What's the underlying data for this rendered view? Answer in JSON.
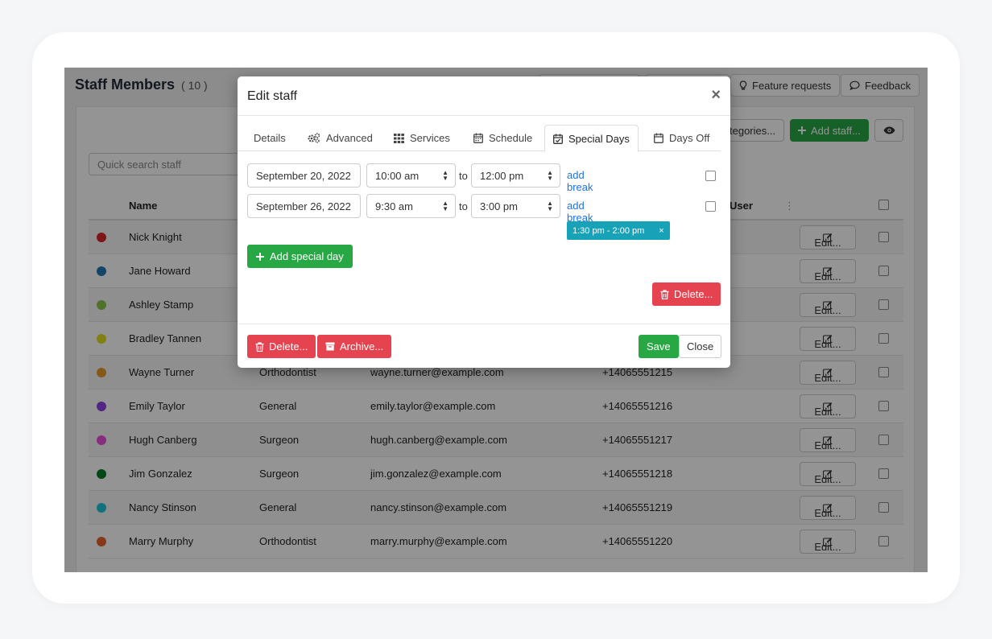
{
  "page": {
    "title": "Staff Members",
    "count": "( 10 )",
    "feature_requests": "Feature requests",
    "feedback": "Feedback",
    "categories_btn": "tegories...",
    "add_staff": "Add staff...",
    "search_placeholder": "Quick search staff"
  },
  "table": {
    "headers": {
      "name": "Name",
      "user": "User"
    },
    "edit_label": "Edit...",
    "rows": [
      {
        "name": "Nick Knight",
        "category": "",
        "email": "",
        "phone": "",
        "color": "#d62728"
      },
      {
        "name": "Jane Howard",
        "category": "",
        "email": "",
        "phone": "",
        "color": "#1f77b4"
      },
      {
        "name": "Ashley Stamp",
        "category": "",
        "email": "",
        "phone": "",
        "color": "#8bc34a"
      },
      {
        "name": "Bradley Tannen",
        "category": "",
        "email": "",
        "phone": "",
        "color": "#dddd22"
      },
      {
        "name": "Wayne Turner",
        "category": "Orthodontist",
        "email": "wayne.turner@example.com",
        "phone": "+14065551215",
        "color": "#e69a28"
      },
      {
        "name": "Emily Taylor",
        "category": "General",
        "email": "emily.taylor@example.com",
        "phone": "+14065551216",
        "color": "#8e3fe6"
      },
      {
        "name": "Hugh Canberg",
        "category": "Surgeon",
        "email": "hugh.canberg@example.com",
        "phone": "+14065551217",
        "color": "#e84fd8"
      },
      {
        "name": "Jim Gonzalez",
        "category": "Surgeon",
        "email": "jim.gonzalez@example.com",
        "phone": "+14065551218",
        "color": "#0b7a2a"
      },
      {
        "name": "Nancy Stinson",
        "category": "General",
        "email": "nancy.stinson@example.com",
        "phone": "+14065551219",
        "color": "#1bc4d6"
      },
      {
        "name": "Marry Murphy",
        "category": "Orthodontist",
        "email": "marry.murphy@example.com",
        "phone": "+14065551220",
        "color": "#e5622a"
      }
    ]
  },
  "modal": {
    "title": "Edit staff",
    "close_symbol": "×",
    "tabs": [
      "Details",
      "Advanced",
      "Services",
      "Schedule",
      "Special Days",
      "Days Off"
    ],
    "special_days": [
      {
        "date": "September 20, 2022",
        "start": "10:00 am",
        "end": "12:00 pm"
      },
      {
        "date": "September 26, 2022",
        "start": "9:30 am",
        "end": "3:00 pm"
      }
    ],
    "to_label": "to",
    "add_break": "add break",
    "break_tag": "1:30 pm - 2:00 pm",
    "break_remove": "×",
    "add_special_day": "Add special day",
    "delete_inner": "Delete...",
    "delete": "Delete...",
    "archive": "Archive...",
    "save": "Save",
    "close": "Close"
  }
}
